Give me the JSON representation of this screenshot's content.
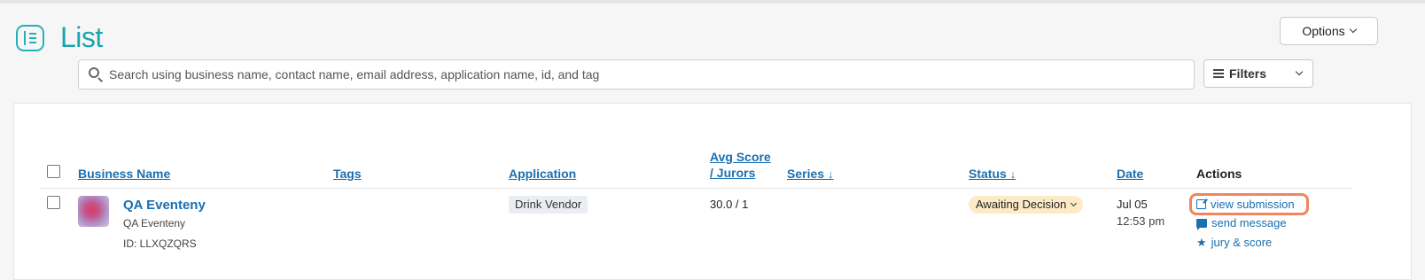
{
  "header": {
    "title": "List",
    "options_label": "Options"
  },
  "search": {
    "placeholder": "Search using business name, contact name, email address, application name, id, and tag",
    "filters_label": "Filters"
  },
  "table": {
    "columns": {
      "business_name": "Business Name",
      "tags": "Tags",
      "application": "Application",
      "avg_score_line1": "Avg Score",
      "avg_score_line2": "/ Jurors",
      "series": "Series",
      "status": "Status",
      "date": "Date",
      "actions": "Actions"
    },
    "sort_arrow": "↓",
    "rows": [
      {
        "business_name": "QA Eventeny",
        "contact_name": "QA Eventeny",
        "id_label": "ID: LLXQZQRS",
        "application": "Drink Vendor",
        "score": "30.0 / 1",
        "status": "Awaiting Decision",
        "date": "Jul 05",
        "time": "12:53 pm",
        "actions": {
          "view": "view submission",
          "message": "send message",
          "jury": "jury & score"
        }
      }
    ]
  },
  "icons": {
    "page": "list-page-icon",
    "search": "search-icon",
    "filters": "sliders-icon",
    "view": "external-link-icon",
    "message": "message-icon",
    "jury": "star-icon"
  },
  "colors": {
    "accent": "#1aa6ae",
    "link": "#1a6fb0",
    "status_bg": "#fdebc8",
    "highlight": "#f0855f"
  }
}
